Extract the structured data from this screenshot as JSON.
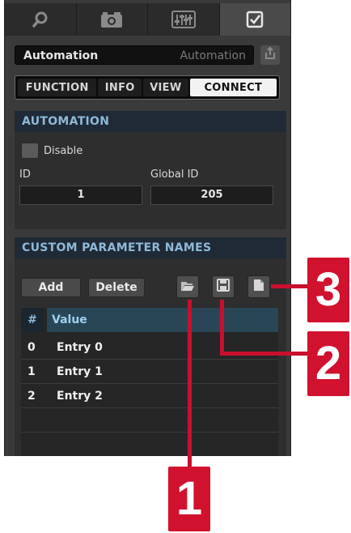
{
  "tabs": [
    {
      "icon": "search-icon"
    },
    {
      "icon": "camera-icon"
    },
    {
      "icon": "mixer-sliders-icon"
    },
    {
      "icon": "checkbox-icon",
      "active": true
    }
  ],
  "name_bar": {
    "value": "Automation",
    "placeholder": "Automation"
  },
  "subtabs": [
    {
      "label": "FUNCTION"
    },
    {
      "label": "INFO"
    },
    {
      "label": "VIEW"
    },
    {
      "label": "CONNECT",
      "active": true
    }
  ],
  "automation": {
    "header": "AUTOMATION",
    "disable_label": "Disable",
    "id_label": "ID",
    "id_value": "1",
    "global_id_label": "Global ID",
    "global_id_value": "205"
  },
  "custom_names": {
    "header": "CUSTOM PARAMETER NAMES",
    "add_label": "Add",
    "delete_label": "Delete",
    "columns": {
      "num": "#",
      "value": "Value"
    },
    "rows": [
      {
        "num": "0",
        "value": "Entry 0"
      },
      {
        "num": "1",
        "value": "Entry 1"
      },
      {
        "num": "2",
        "value": "Entry 2"
      }
    ]
  },
  "callouts": {
    "one": "1",
    "two": "2",
    "three": "3"
  },
  "colors": {
    "accent_header": "#8fb9d9",
    "callout_red": "#d0122e",
    "panel_bg": "#3a3a3a"
  }
}
